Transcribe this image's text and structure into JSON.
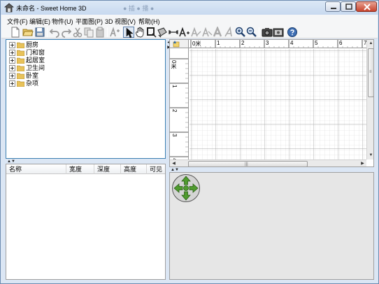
{
  "window": {
    "title": "未命名 - Sweet Home 3D",
    "ghost_title": "● 插 ● 播 ●",
    "controls": [
      "minimize",
      "maximize",
      "close"
    ]
  },
  "menu": {
    "items": [
      "文件(F)",
      "编辑(E)",
      "物件(U)",
      "平面图(P)",
      "3D 视图(V)",
      "帮助(H)"
    ]
  },
  "toolbar": {
    "buttons": [
      "new-file",
      "open-file",
      "save-file",
      "undo",
      "redo",
      "cut",
      "copy",
      "paste",
      "add-furniture",
      "select-mode",
      "pan-mode",
      "create-walls",
      "create-rooms",
      "create-dimensions",
      "add-text",
      "modify-text-style-1",
      "modify-text-style-2",
      "bold-text",
      "italic-text",
      "zoom-in",
      "zoom-out",
      "create-photo",
      "create-video",
      "help"
    ]
  },
  "catalog": {
    "categories": [
      "厨房",
      "门和窗",
      "起居室",
      "卫生间",
      "卧室",
      "杂项"
    ]
  },
  "furniture_table": {
    "columns": [
      "名称",
      "宽度",
      "深度",
      "高度",
      "可见"
    ]
  },
  "plan": {
    "ruler_unit": "米",
    "h_ticks": [
      "0米",
      "1",
      "2",
      "3",
      "4",
      "5",
      "6",
      "7"
    ],
    "v_ticks": [
      "0米",
      "1",
      "2",
      "3",
      "4"
    ]
  },
  "view3d": {
    "navigation": [
      "move-forward",
      "move-backward",
      "turn-left",
      "turn-right"
    ]
  }
}
